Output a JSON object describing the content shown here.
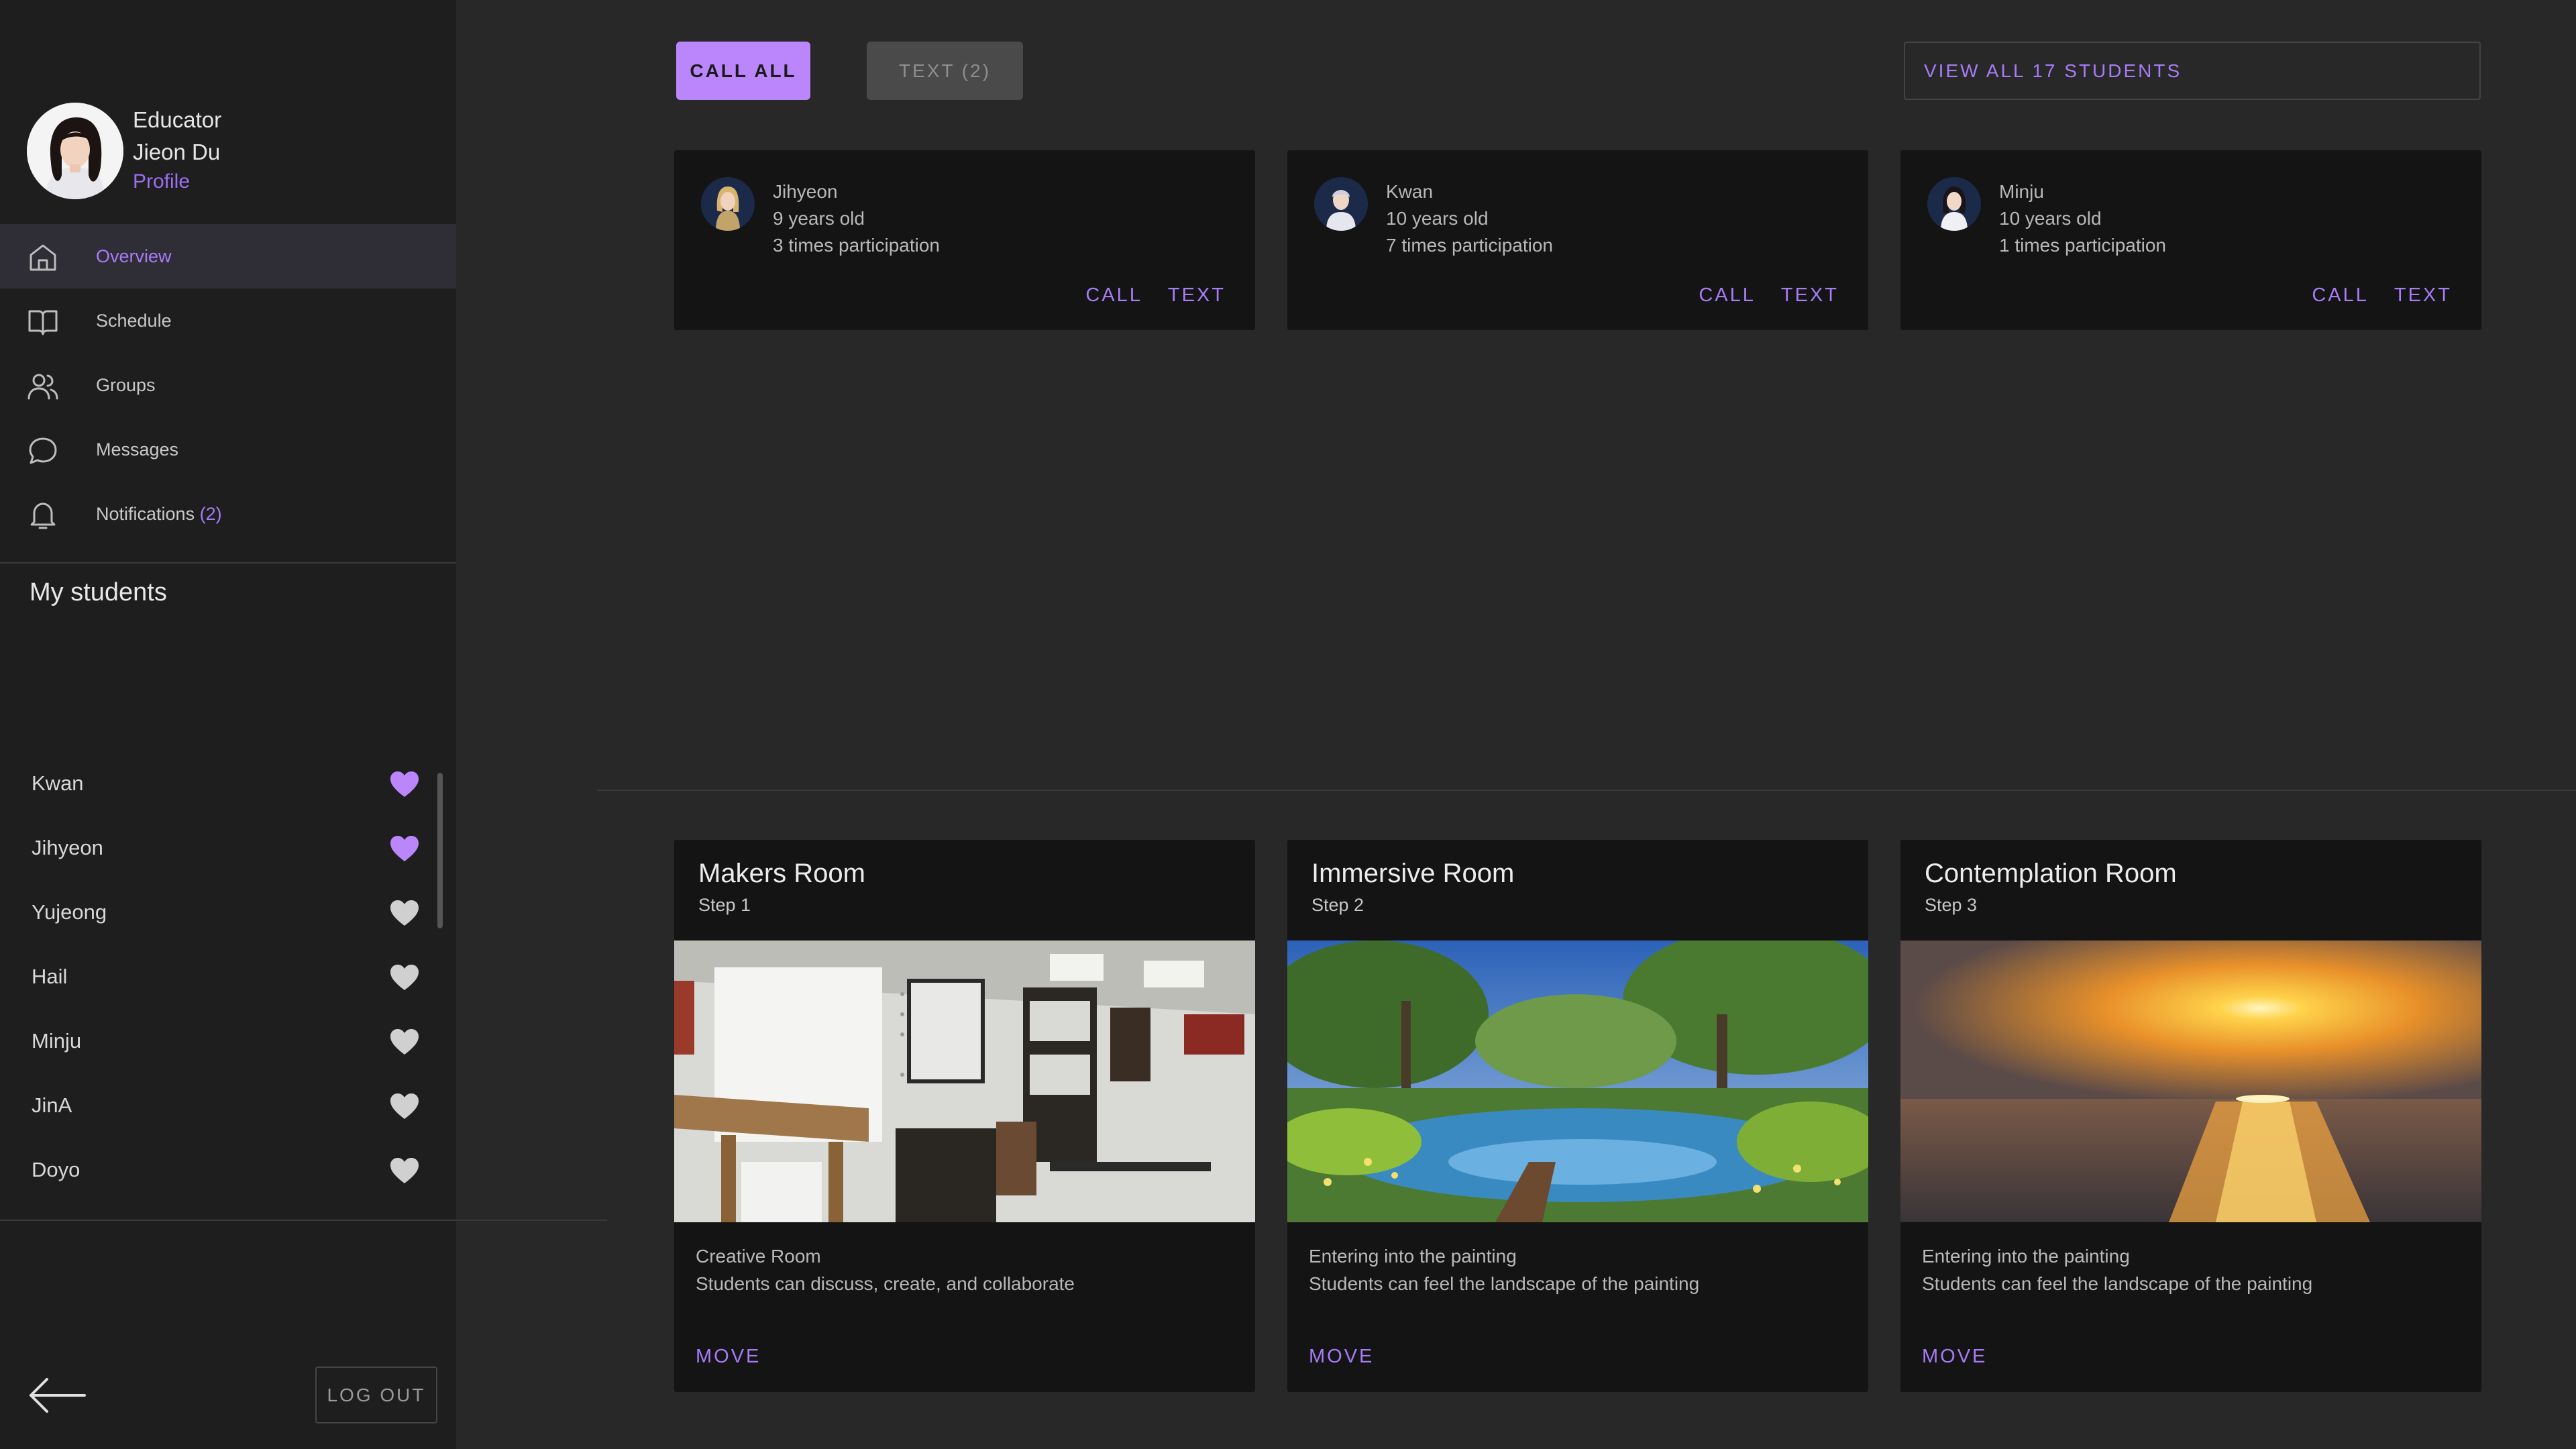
{
  "profile": {
    "role": "Educator",
    "name": "Jieon Du",
    "link": "Profile"
  },
  "nav": [
    {
      "label": "Overview",
      "icon": "home-icon",
      "active": true
    },
    {
      "label": "Schedule",
      "icon": "book-icon"
    },
    {
      "label": "Groups",
      "icon": "users-icon"
    },
    {
      "label": "Messages",
      "icon": "message-icon"
    },
    {
      "label": "Notifications",
      "badge": "(2)",
      "icon": "bell-icon"
    }
  ],
  "my_students": {
    "heading": "My students",
    "list": [
      {
        "name": "Kwan",
        "favorite": true
      },
      {
        "name": "Jihyeon",
        "favorite": true
      },
      {
        "name": "Yujeong",
        "favorite": false
      },
      {
        "name": "Hail",
        "favorite": false
      },
      {
        "name": "Minju",
        "favorite": false
      },
      {
        "name": "JinA",
        "favorite": false
      },
      {
        "name": "Doyo",
        "favorite": false
      }
    ]
  },
  "logout_label": "LOG OUT",
  "toolbar": {
    "call_all": "CALL ALL",
    "text": "TEXT (2)",
    "view_all": "VIEW ALL 17 STUDENTS"
  },
  "student_cards": [
    {
      "name": "Jihyeon",
      "age": "9 years old",
      "participation": "3 times participation",
      "call": "CALL",
      "text": "TEXT"
    },
    {
      "name": "Kwan",
      "age": "10 years old",
      "participation": "7 times participation",
      "call": "CALL",
      "text": "TEXT"
    },
    {
      "name": "Minju",
      "age": "10 years old",
      "participation": "1 times participation",
      "call": "CALL",
      "text": "TEXT"
    }
  ],
  "rooms": [
    {
      "title": "Makers Room",
      "step": "Step 1",
      "desc1": "Creative Room",
      "desc2": "Students can discuss, create, and collaborate",
      "action": "MOVE"
    },
    {
      "title": "Immersive Room",
      "step": "Step 2",
      "desc1": "Entering into the painting",
      "desc2": "Students can feel the landscape of the painting",
      "action": "MOVE"
    },
    {
      "title": "Contemplation Room",
      "step": "Step 3",
      "desc1": "Entering into the painting",
      "desc2": "Students can feel the landscape of the painting",
      "action": "MOVE"
    }
  ],
  "colors": {
    "accent": "#bb86fc",
    "accent_text": "#a77cf7",
    "heart_off": "#d0d0d0",
    "panel": "#141414",
    "sidebar": "#1e1e1e",
    "background": "#282828"
  }
}
